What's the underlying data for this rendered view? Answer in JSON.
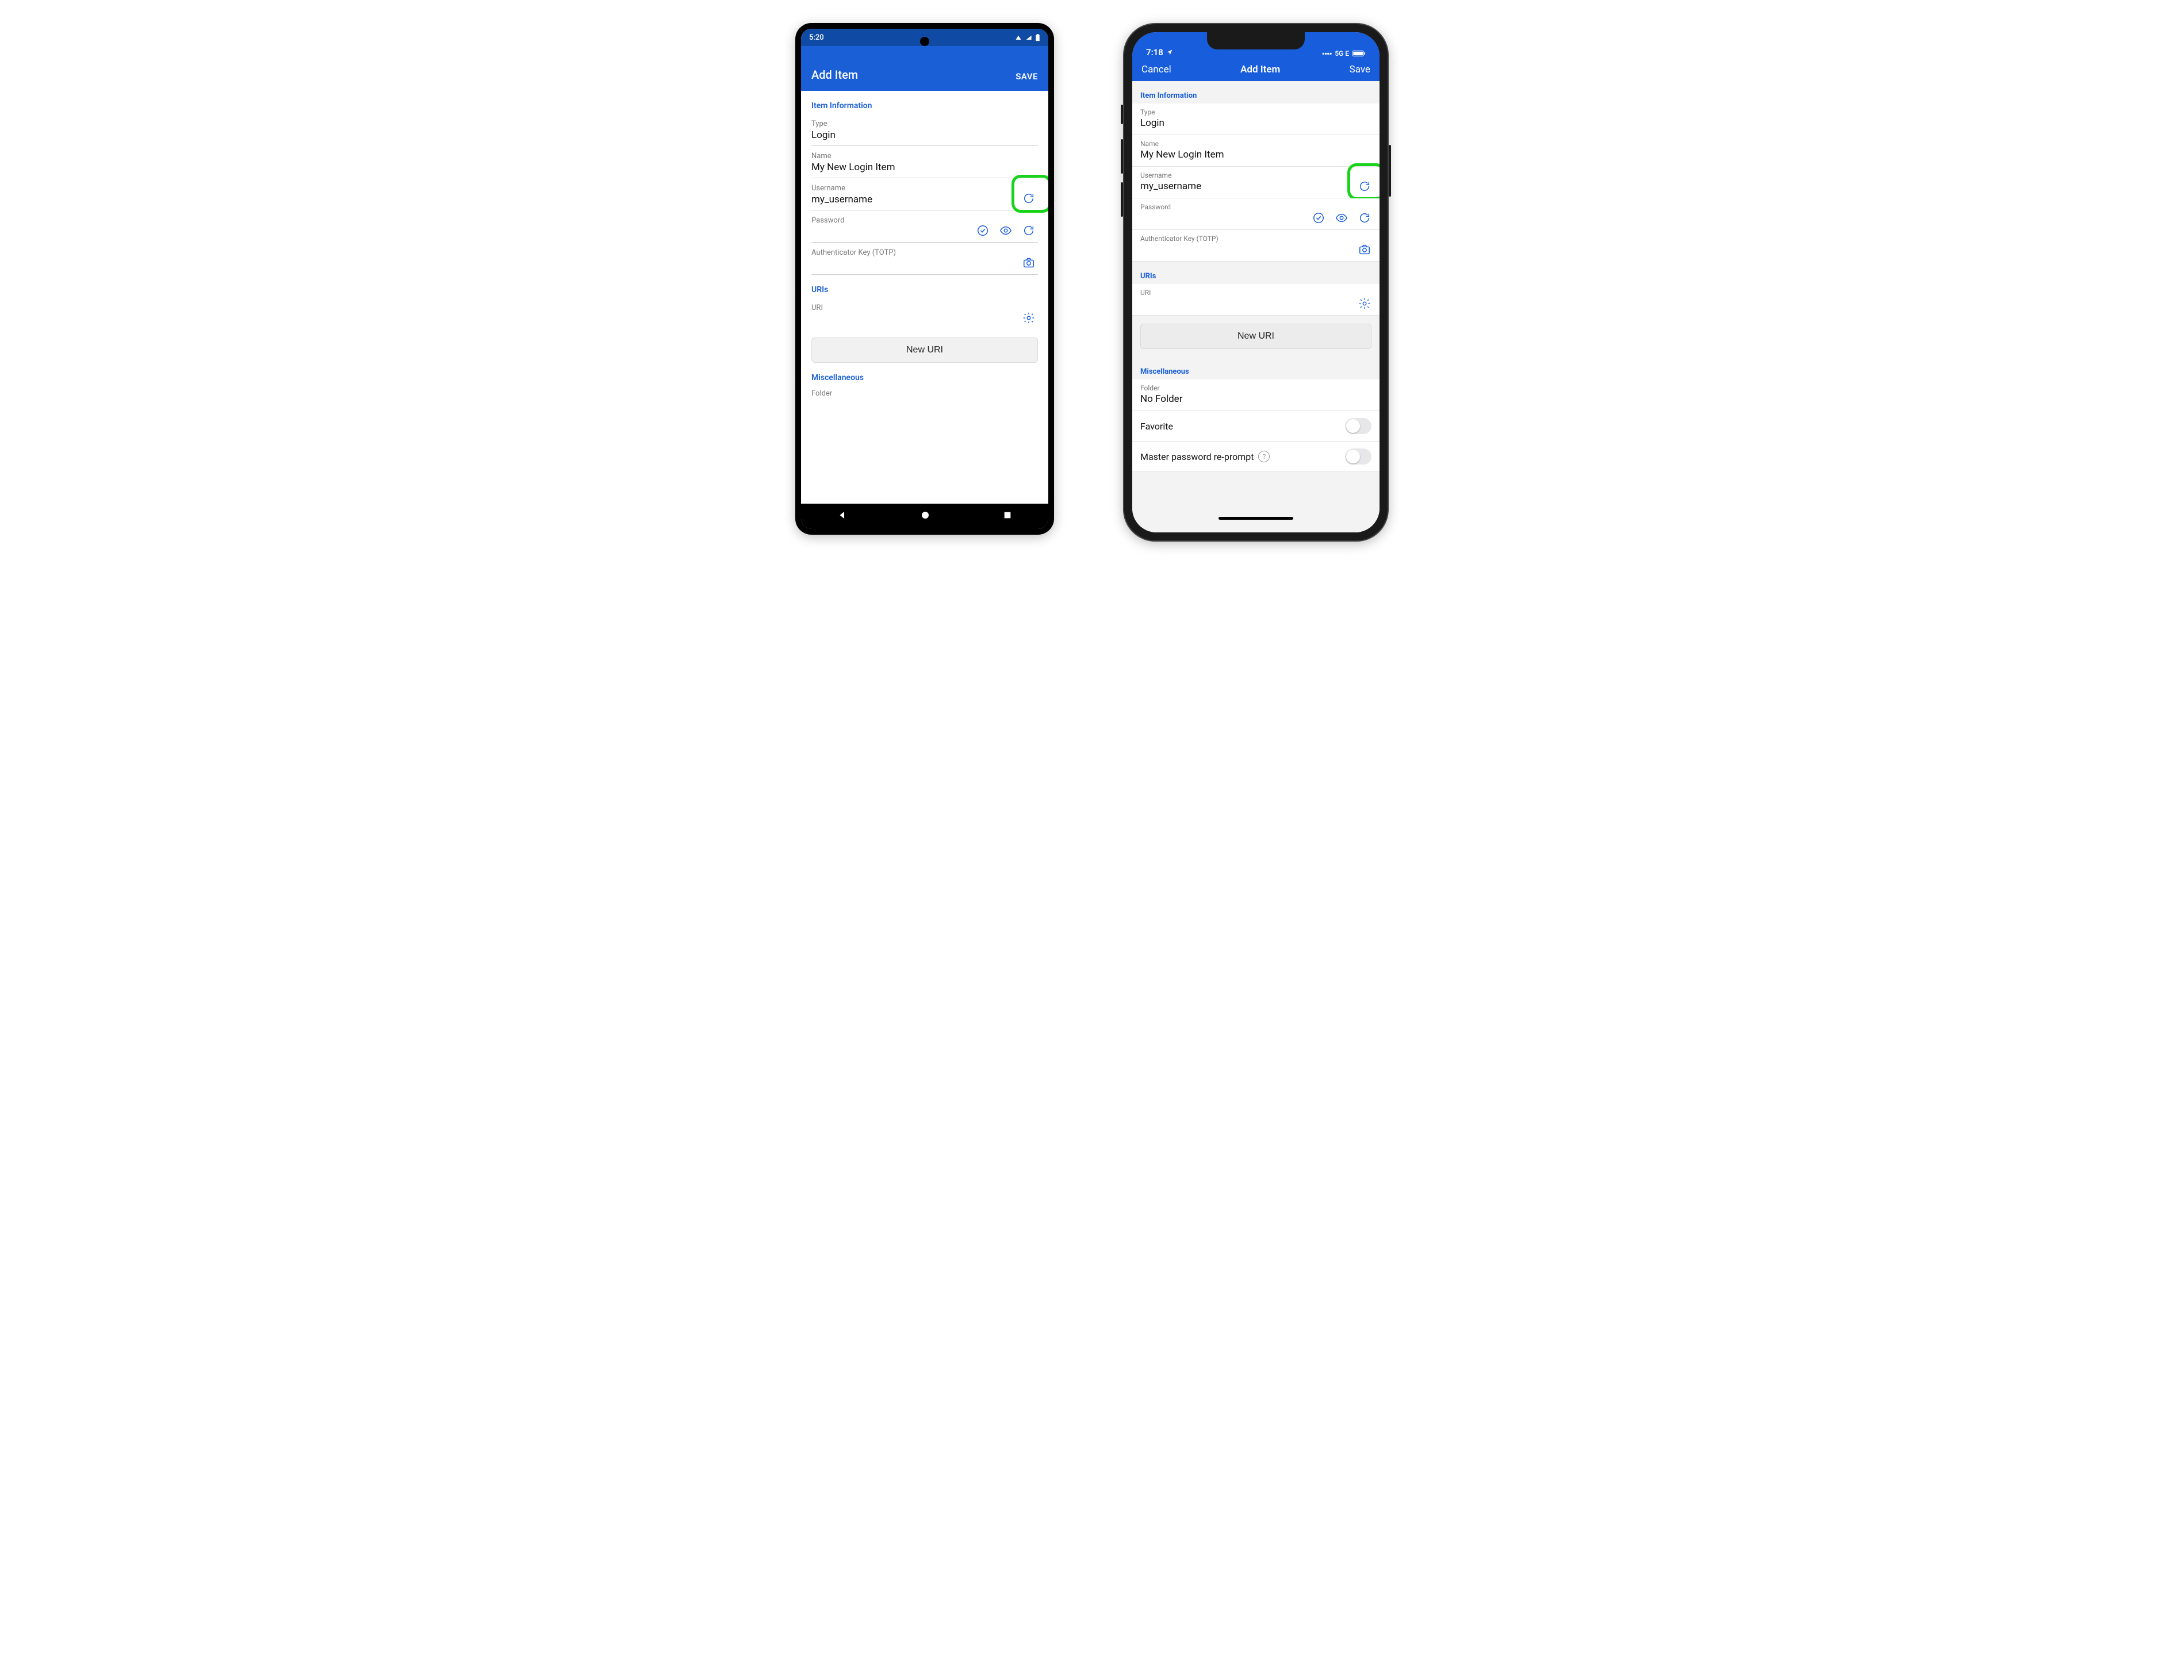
{
  "android": {
    "status": {
      "time": "5:20",
      "indicators": "▾◢ ▮"
    },
    "appbar": {
      "title": "Add Item",
      "save": "SAVE"
    },
    "sections": {
      "item_info": "Item Information",
      "uris": "URIs",
      "misc": "Miscellaneous"
    },
    "fields": {
      "type": {
        "label": "Type",
        "value": "Login"
      },
      "name": {
        "label": "Name",
        "value": "My New Login Item"
      },
      "username": {
        "label": "Username",
        "value": "my_username"
      },
      "password": {
        "label": "Password",
        "value": ""
      },
      "totp": {
        "label": "Authenticator Key (TOTP)",
        "value": ""
      },
      "uri": {
        "label": "URI",
        "value": ""
      },
      "folder": {
        "label": "Folder"
      }
    },
    "buttons": {
      "new_uri": "New URI"
    }
  },
  "iphone": {
    "status": {
      "time": "7:18",
      "network": "5G E"
    },
    "nav": {
      "cancel": "Cancel",
      "title": "Add Item",
      "save": "Save"
    },
    "sections": {
      "item_info": "Item Information",
      "uris": "URIs",
      "misc": "Miscellaneous"
    },
    "fields": {
      "type": {
        "label": "Type",
        "value": "Login"
      },
      "name": {
        "label": "Name",
        "value": "My New Login Item"
      },
      "username": {
        "label": "Username",
        "value": "my_username"
      },
      "password": {
        "label": "Password",
        "value": ""
      },
      "totp": {
        "label": "Authenticator Key (TOTP)",
        "value": ""
      },
      "uri": {
        "label": "URI",
        "value": ""
      },
      "folder": {
        "label": "Folder",
        "value": "No Folder"
      },
      "favorite": {
        "label": "Favorite"
      },
      "reprompt": {
        "label": "Master password re-prompt"
      }
    },
    "buttons": {
      "new_uri": "New URI"
    }
  }
}
